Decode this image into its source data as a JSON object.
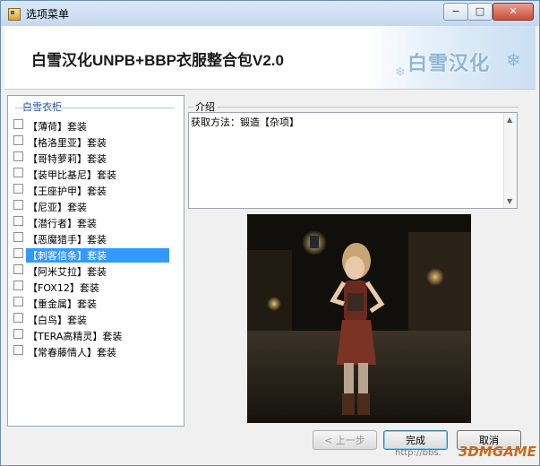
{
  "window": {
    "title": "选项菜单",
    "controls": {
      "minimize": "−",
      "maximize": "□",
      "close": "✕"
    }
  },
  "banner": {
    "title": "白雪汉化UNPB+BBP衣服整合包V2.0",
    "logo_text": "白雪汉化",
    "snowflake": "❄"
  },
  "wardrobe": {
    "title": "白雪衣柜",
    "items": [
      {
        "label": "【薄荷】套装",
        "selected": false
      },
      {
        "label": "【格洛里亚】套装",
        "selected": false
      },
      {
        "label": "【哥特萝莉】套装",
        "selected": false
      },
      {
        "label": "【装甲比基尼】套装",
        "selected": false
      },
      {
        "label": "【王座护甲】套装",
        "selected": false
      },
      {
        "label": "【尼亚】套装",
        "selected": false
      },
      {
        "label": "【潜行者】套装",
        "selected": false
      },
      {
        "label": "【恶魔猎手】套装",
        "selected": false
      },
      {
        "label": "【刺客信条】套装",
        "selected": true
      },
      {
        "label": "【阿米艾拉】套装",
        "selected": false
      },
      {
        "label": "【FOX12】套装",
        "selected": false
      },
      {
        "label": "【重金属】套装",
        "selected": false
      },
      {
        "label": "【白鸟】套装",
        "selected": false
      },
      {
        "label": "【TERA高精灵】套装",
        "selected": false
      },
      {
        "label": "【常春藤情人】套装",
        "selected": false
      }
    ]
  },
  "intro": {
    "title": "介绍",
    "text": "获取方法：锻造【杂项】"
  },
  "buttons": {
    "prev": "< 上一步",
    "done": "完成",
    "cancel": "取消"
  },
  "watermark": {
    "text": "http://bbs.",
    "logo": "3DMGAME"
  },
  "colors": {
    "selection": "#3399ff",
    "group_title": "#1f4fa0",
    "window_border": "#6b8db5"
  }
}
